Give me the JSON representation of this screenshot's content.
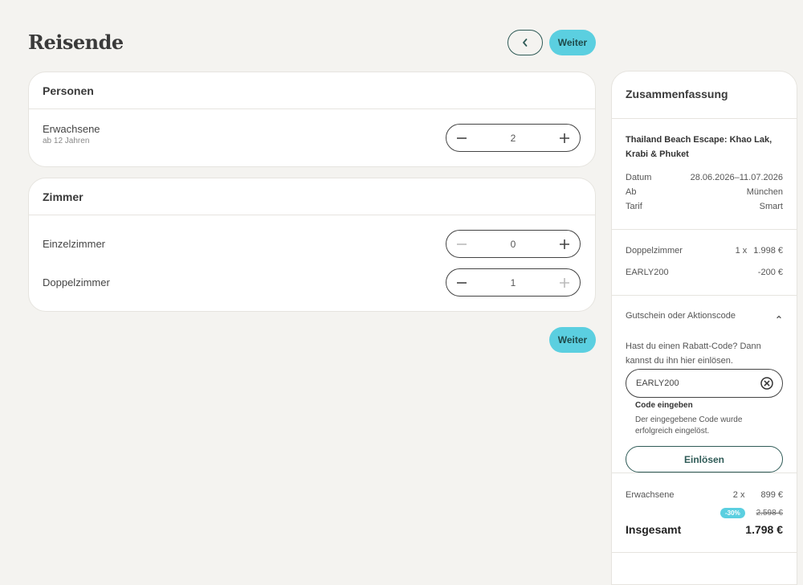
{
  "page": {
    "title": "Reisende",
    "next_label": "Weiter"
  },
  "persons_card": {
    "title": "Personen",
    "adults": {
      "label": "Erwachsene",
      "sub": "ab 12 Jahren",
      "value": "2"
    }
  },
  "rooms_card": {
    "title": "Zimmer",
    "single": {
      "label": "Einzelzimmer",
      "value": "0"
    },
    "double": {
      "label": "Doppelzimmer",
      "value": "1"
    }
  },
  "summary": {
    "title": "Zusammenfassung",
    "trip_name": "Thailand Beach Escape: Khao Lak, Krabi & Phuket",
    "details": [
      {
        "key": "Datum",
        "value": "28.06.2026–11.07.2026"
      },
      {
        "key": "Ab",
        "value": "München"
      },
      {
        "key": "Tarif",
        "value": "Smart"
      }
    ],
    "room_line": {
      "label": "Doppelzimmer",
      "qty": "1 x",
      "price": "1.998 €"
    },
    "discount_line": {
      "label": "EARLY200",
      "price": "-200 €"
    },
    "coupon": {
      "title": "Gutschein oder Aktionscode",
      "text": "Hast du einen Rabatt-Code? Dann kannst du ihn hier einlösen.",
      "value": "EARLY200",
      "field_label": "Code eingeben",
      "message": "Der eingegebene Code wurde erfolgreich eingelöst.",
      "button": "Einlösen"
    },
    "adults_line": {
      "label": "Erwachsene",
      "qty": "2 x",
      "price": "899 €"
    },
    "badge": "-30%",
    "old_price": "2.598 €",
    "total_label": "Insgesamt",
    "total_value": "1.798 €"
  },
  "colors": {
    "accent": "#5bcfe0",
    "dark_green": "#2f5b57",
    "background": "#f4f3f0"
  },
  "icons": [
    "chevron-left-icon",
    "minus-icon",
    "plus-icon",
    "chevron-up-icon",
    "clear-icon"
  ]
}
